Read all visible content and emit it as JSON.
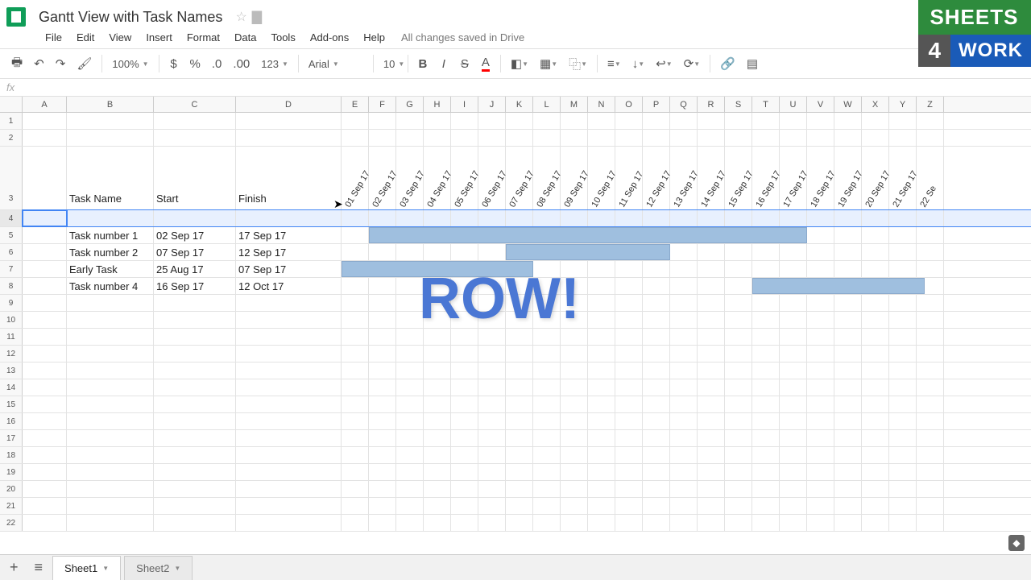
{
  "doc": {
    "title": "Gantt View with Task Names",
    "save_status": "All changes saved in Drive"
  },
  "menu": [
    "File",
    "Edit",
    "View",
    "Insert",
    "Format",
    "Data",
    "Tools",
    "Add-ons",
    "Help"
  ],
  "toolbar": {
    "zoom": "100%",
    "font": "Arial",
    "fontsize": "10"
  },
  "columns": {
    "A": 55,
    "B": 108,
    "C": 102,
    "D": 131,
    "narrow": [
      "E",
      "F",
      "G",
      "H",
      "I",
      "J",
      "K",
      "L",
      "M",
      "N",
      "O",
      "P",
      "Q",
      "R",
      "S",
      "T",
      "U",
      "V",
      "W",
      "X",
      "Y",
      "Z"
    ],
    "narrow_w": 34
  },
  "headers": {
    "task": "Task Name",
    "start": "Start",
    "finish": "Finish"
  },
  "tasks": [
    {
      "name": "Task number 1",
      "start": "02 Sep 17",
      "finish": "17 Sep 17",
      "bar_start_col": 1,
      "bar_end_col": 16
    },
    {
      "name": "Task number 2",
      "start": "07 Sep 17",
      "finish": "12 Sep 17",
      "bar_start_col": 6,
      "bar_end_col": 11
    },
    {
      "name": "Early Task",
      "start": "25 Aug 17",
      "finish": "07 Sep 17",
      "bar_start_col": 0,
      "bar_end_col": 6
    },
    {
      "name": "Task number 4",
      "start": "16 Sep 17",
      "finish": "12 Oct 17",
      "bar_start_col": 15,
      "bar_end_col": 22
    }
  ],
  "dates": [
    "01 Sep 17",
    "02 Sep 17",
    "03 Sep 17",
    "04 Sep 17",
    "05 Sep 17",
    "06 Sep 17",
    "07 Sep 17",
    "08 Sep 17",
    "09 Sep 17",
    "10 Sep 17",
    "11 Sep 17",
    "12 Sep 17",
    "13 Sep 17",
    "14 Sep 17",
    "15 Sep 17",
    "16 Sep 17",
    "17 Sep 17",
    "18 Sep 17",
    "19 Sep 17",
    "20 Sep 17",
    "21 Sep 17",
    "22 Se"
  ],
  "overlay_text": "ROW!",
  "sheets": [
    "Sheet1",
    "Sheet2"
  ],
  "brand": {
    "top": "SHEETS",
    "num": "4",
    "bottom": "WORK"
  },
  "row_count": 22
}
